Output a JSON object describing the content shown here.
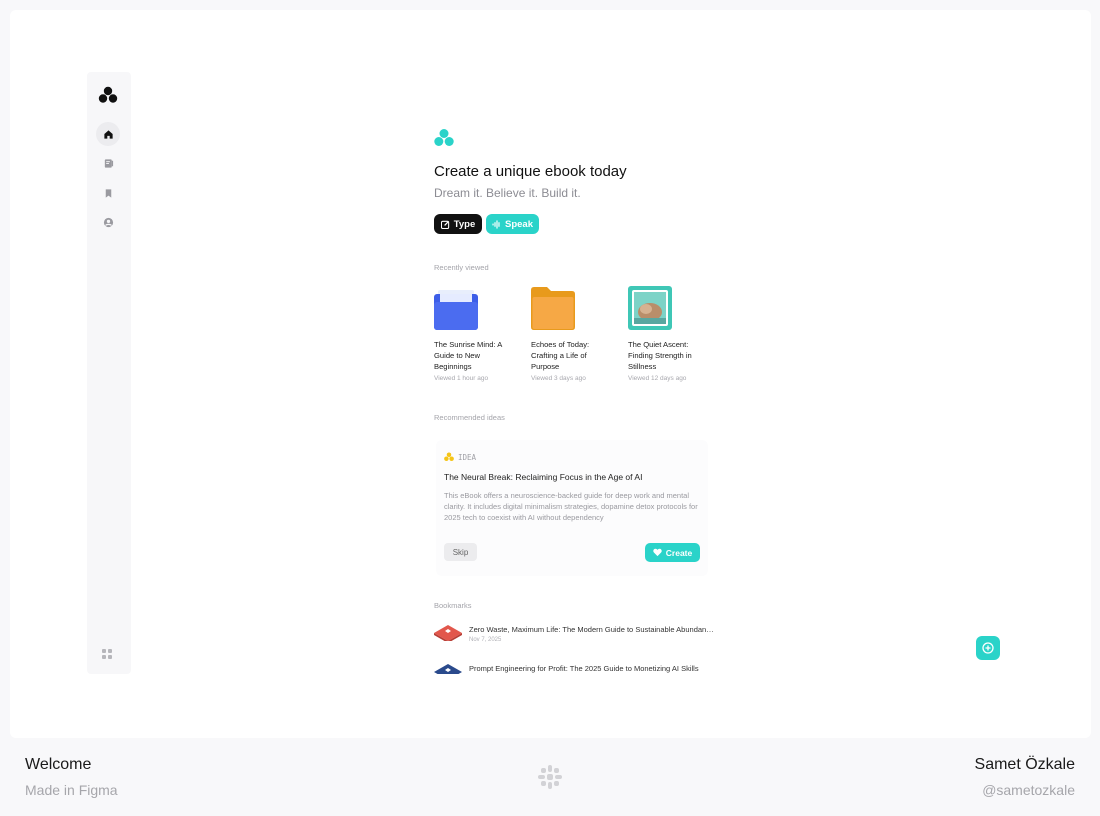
{
  "sidebar": {
    "logo_icon": "trefoil-logo-icon",
    "items": [
      {
        "name": "home",
        "icon": "home-icon",
        "active": true
      },
      {
        "name": "library",
        "icon": "book-icon",
        "active": false
      },
      {
        "name": "bookmarks",
        "icon": "bookmark-icon",
        "active": false
      },
      {
        "name": "profile",
        "icon": "user-circle-icon",
        "active": false
      }
    ],
    "bottom_icon": "grid-icon"
  },
  "hero": {
    "title": "Create a unique ebook today",
    "subtitle": "Dream it. Believe it. Build it.",
    "type_label": "Type",
    "speak_label": "Speak"
  },
  "recent": {
    "label": "Recently viewed",
    "items": [
      {
        "title": "The Sunrise Mind: A Guide to New Beginnings",
        "time": "Viewed 1 hour ago",
        "thumb": "blue-folder"
      },
      {
        "title": "Echoes of Today: Crafting a Life of Purpose",
        "time": "Viewed 3 days ago",
        "thumb": "orange-folder"
      },
      {
        "title": "The Quiet Ascent: Finding Strength in Stillness",
        "time": "Viewed 12 days ago",
        "thumb": "photo-frame"
      }
    ]
  },
  "ideas": {
    "label": "Recommended ideas",
    "tag": "IDEA",
    "title": "The Neural Break: Reclaiming Focus in the Age of AI",
    "description": "This eBook offers a neuroscience-backed guide for deep work and mental clarity. It includes digital minimalism strategies, dopamine detox protocols for 2025 tech to coexist with AI without dependency",
    "skip_label": "Skip",
    "create_label": "Create"
  },
  "bookmarks": {
    "label": "Bookmarks",
    "items": [
      {
        "title": "Zero Waste, Maximum Life: The Modern Guide to Sustainable Abundance",
        "date": "Nov 7, 2025"
      },
      {
        "title": "Prompt Engineering for Profit: The 2025 Guide to Monetizing AI Skills",
        "date": ""
      }
    ]
  },
  "footer": {
    "left_title": "Welcome",
    "left_sub": "Made in Figma",
    "right_title": "Samet Özkale",
    "right_sub": "@sametozkale"
  },
  "colors": {
    "accent": "#2ad3c9",
    "dark": "#111111",
    "idea_yellow": "#f5c518"
  }
}
